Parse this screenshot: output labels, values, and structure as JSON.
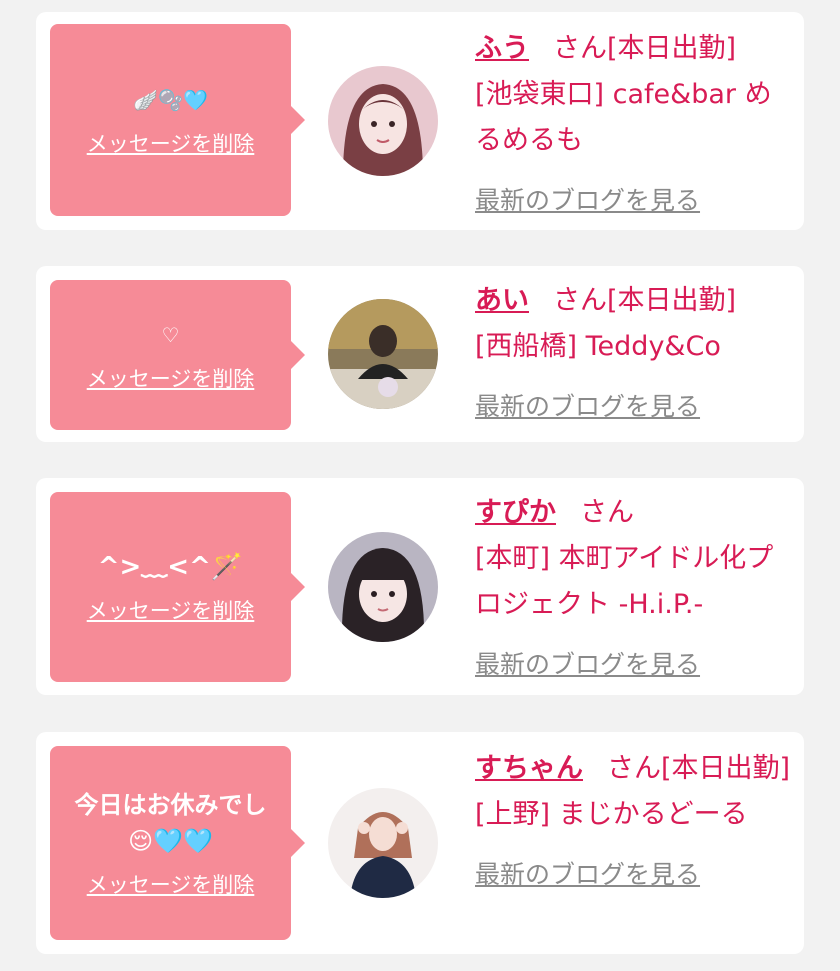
{
  "colors": {
    "bubble": "#f68b97",
    "accent": "#d81b55",
    "link_gray": "#8a8a8a",
    "background": "#f2f2f2"
  },
  "cards": [
    {
      "message": "🪽🫧🩵",
      "delete_label": "メッセージを削除",
      "name": "ふう",
      "suffix": "さん[本日出勤]",
      "shop": "[池袋東口] cafe&bar めるめるも",
      "blog_label": "最新のブログを見る",
      "avatar_icon": "woman-portrait-avatar"
    },
    {
      "message": "♡",
      "delete_label": "メッセージを削除",
      "name": "あい",
      "suffix": "さん[本日出勤]",
      "shop": "[西船橋] Teddy&Co",
      "blog_label": "最新のブログを見る",
      "avatar_icon": "woman-cafe-avatar"
    },
    {
      "message": "^>﹏<^🪄",
      "delete_label": "メッセージを削除",
      "name": "すぴか",
      "suffix": "さん",
      "shop": "[本町] 本町アイドル化プロジェクト -H.i.P.-",
      "blog_label": "最新のブログを見る",
      "avatar_icon": "woman-portrait-avatar"
    },
    {
      "message": "今日はお休みでし😌🩵🩵",
      "delete_label": "メッセージを削除",
      "name": "すちゃん",
      "suffix": "さん[本日出勤]",
      "shop": "[上野] まじかるどーる",
      "blog_label": "最新のブログを見る",
      "avatar_icon": "woman-pose-avatar"
    }
  ]
}
